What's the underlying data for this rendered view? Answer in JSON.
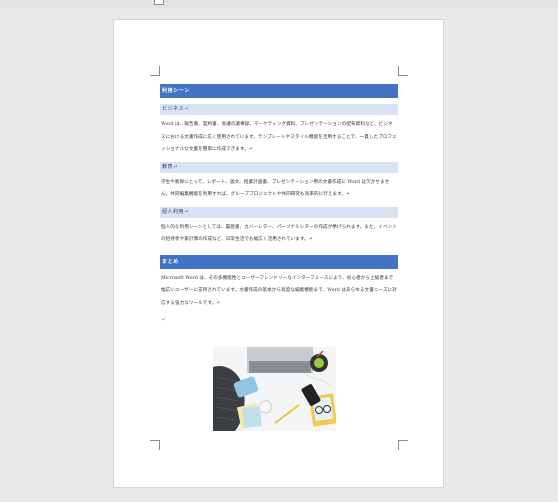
{
  "document": {
    "section1": {
      "heading": "利用シーン",
      "sub1": {
        "heading": "ビジネス↵",
        "text": "Word は、報告書、契約書、会議の議事録、マーケティング資料、プレゼンテーションの配布資料など、ビジネスにおける文書作成に広く使用されています。テンプレートやスタイル機能を活用することで、一貫したプロフェッショナルな文書を簡単に作成できます。↵"
      },
      "sub2": {
        "heading": "教育↵",
        "text": "学生や教師にとって、レポート、論文、授業計画書、プレゼンテーション用の文書作成に Word は欠かせません。共同編集機能を利用すれば、グループプロジェクトや共同研究も効率的に行えます。↵"
      },
      "sub3": {
        "heading": "個人利用↵",
        "text": "個人的な利用シーンとしては、履歴書、カバーレター、パーソナルレターの作成が挙げられます。また、イベントの招待状や家計簿の作成など、日常生活でも幅広く活用されています。↵"
      }
    },
    "section2": {
      "heading": "まとめ",
      "text": "Microsoft Word は、その多機能性とユーザーフレンドリーなインターフェースにより、初心者から上級者まで幅広いユーザーに支持されています。文書作成の基本から高度な編集機能まで、Word はあらゆる文書ニーズに対応する強力なツールです。↵"
    },
    "empty_paragraph_mark": "↵"
  }
}
